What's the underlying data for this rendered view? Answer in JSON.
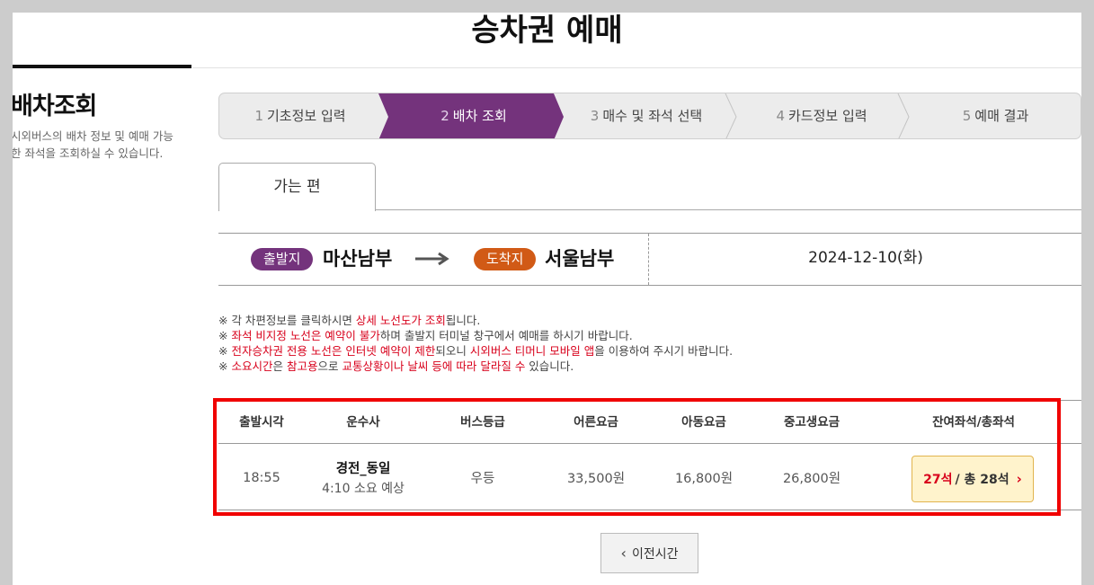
{
  "page_title": "승차권 예매",
  "side": {
    "heading": "배차조회",
    "description": "시외버스의 배차 정보 및 예매 가능한 좌석을 조회하실 수 있습니다."
  },
  "steps": [
    {
      "num": "1",
      "label": "기초정보 입력"
    },
    {
      "num": "2",
      "label": "배차 조회"
    },
    {
      "num": "3",
      "label": "매수 및 좌석 선택"
    },
    {
      "num": "4",
      "label": "카드정보 입력"
    },
    {
      "num": "5",
      "label": "예매 결과"
    }
  ],
  "active_step": 2,
  "colors": {
    "accent": "#74337c",
    "departure": "#74337c",
    "arrival": "#d15a16",
    "warning": "#d8001b",
    "highlight": "#f00000"
  },
  "tab": {
    "label": "가는 편"
  },
  "route": {
    "departure_badge": "출발지",
    "departure": "마산남부",
    "arrival_badge": "도착지",
    "arrival": "서울남부",
    "date": "2024-12-10(화)"
  },
  "notices": [
    {
      "parts": [
        {
          "t": "※ 각 차편정보를 클릭하시면 "
        },
        {
          "t": "상세 노선도가 조회",
          "red": true
        },
        {
          "t": "됩니다."
        }
      ]
    },
    {
      "parts": [
        {
          "t": "※ "
        },
        {
          "t": "좌석 비지정 노선은 예약이 불가",
          "red": true
        },
        {
          "t": "하며 출발지 터미널 창구에서 예매를 하시기 바랍니다."
        }
      ]
    },
    {
      "parts": [
        {
          "t": "※ "
        },
        {
          "t": "전자승차권 전용 노선은 인터넷 예약이 제한",
          "red": true
        },
        {
          "t": "되오니 "
        },
        {
          "t": "시외버스 티머니 모바일 앱",
          "red": true
        },
        {
          "t": "을 이용하여 주시기 바랍니다."
        }
      ]
    },
    {
      "parts": [
        {
          "t": "※ "
        },
        {
          "t": "소요시간",
          "red": true
        },
        {
          "t": "은 "
        },
        {
          "t": "참고용",
          "red": true
        },
        {
          "t": "으로 "
        },
        {
          "t": "교통상황이나 날씨 등에 따라 달라질 수",
          "red": true
        },
        {
          "t": " 있습니다."
        }
      ]
    }
  ],
  "table": {
    "headers": [
      "출발시각",
      "운수사",
      "버스등급",
      "어른요금",
      "아동요금",
      "중고생요금",
      "잔여좌석/총좌석"
    ],
    "rows": [
      {
        "time": "18:55",
        "company": "경전_동일",
        "duration": "4:10 소요 예상",
        "grade": "우등",
        "adult": "33,500원",
        "child": "16,800원",
        "youth": "26,800원",
        "remaining": "27석",
        "total": "/ 총 28석"
      }
    ]
  },
  "prev_button": {
    "label": "이전시간"
  },
  "icons": {
    "seat_chevron": "chevron-right-icon",
    "prev_chevron": "chevron-left-icon",
    "route_arrow": "arrow-right-icon"
  }
}
